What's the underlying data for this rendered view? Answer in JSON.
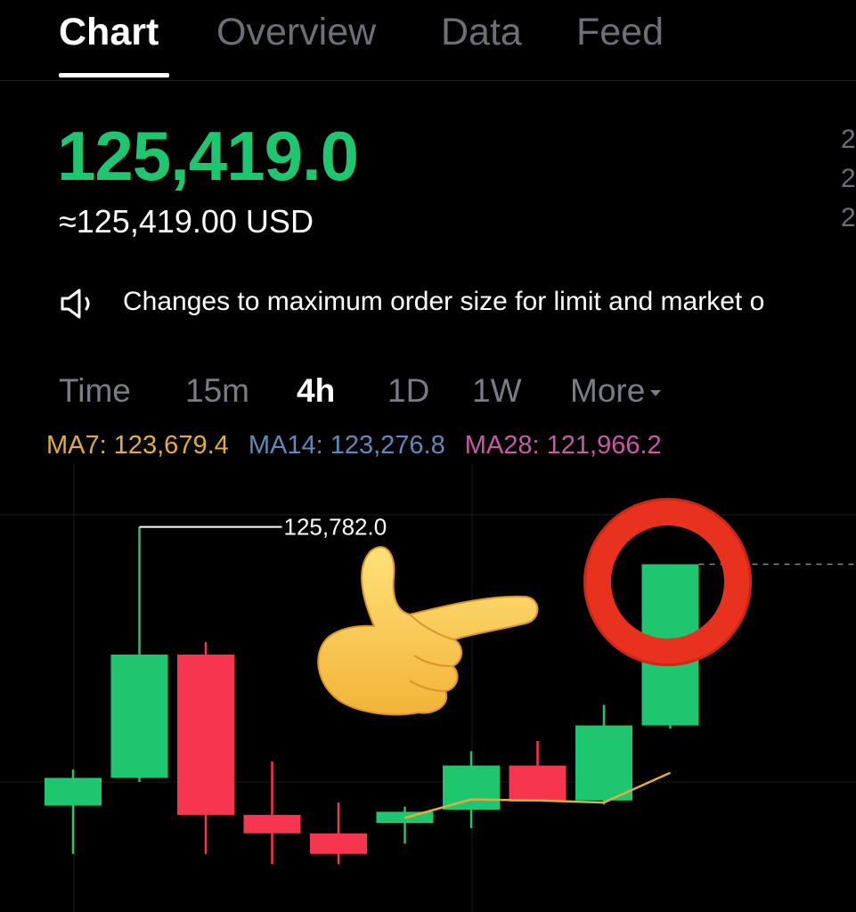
{
  "tabs": [
    {
      "label": "Chart",
      "active": true
    },
    {
      "label": "Overview",
      "active": false
    },
    {
      "label": "Data",
      "active": false
    },
    {
      "label": "Feed",
      "active": false
    }
  ],
  "price": {
    "value": "125,419.0",
    "converted": "≈125,419.00 USD",
    "color": "#1ec66f"
  },
  "side_values": [
    "2",
    "2",
    "2"
  ],
  "announcement": {
    "icon": "speaker-icon",
    "text": "Changes to maximum order size for limit and market o"
  },
  "intervals": [
    {
      "label": "Time",
      "active": false
    },
    {
      "label": "15m",
      "active": false
    },
    {
      "label": "4h",
      "active": true
    },
    {
      "label": "1D",
      "active": false
    },
    {
      "label": "1W",
      "active": false
    },
    {
      "label": "More",
      "active": false
    }
  ],
  "ma": [
    {
      "label": "MA7: 123,679.4",
      "color": "#e2ad3f"
    },
    {
      "label": "MA14: 123,276.8",
      "color": "#5e8bb7"
    },
    {
      "label": "MA28: 121,966.2",
      "color": "#c85aa6"
    }
  ],
  "overlays": {
    "hand": "pointing-hand-emoji",
    "ring": "red-circle-ring"
  },
  "chart_data": {
    "type": "candlestick",
    "colors": {
      "up": "#1ec66f",
      "down": "#f6364f"
    },
    "high_label": "125,782.0",
    "ylim": [
      122800,
      125900
    ],
    "candles": [
      {
        "o": 123070,
        "h": 123420,
        "l": 122600,
        "c": 123340
      },
      {
        "o": 123340,
        "h": 125782,
        "l": 123300,
        "c": 124540
      },
      {
        "o": 124540,
        "h": 124660,
        "l": 122600,
        "c": 122980
      },
      {
        "o": 122980,
        "h": 123500,
        "l": 122500,
        "c": 122800
      },
      {
        "o": 122800,
        "h": 123100,
        "l": 122500,
        "c": 122600
      },
      {
        "o": 122900,
        "h": 123060,
        "l": 122700,
        "c": 123010
      },
      {
        "o": 123030,
        "h": 123600,
        "l": 122850,
        "c": 123460
      },
      {
        "o": 123460,
        "h": 123700,
        "l": 123120,
        "c": 123110
      },
      {
        "o": 123120,
        "h": 124050,
        "l": 123080,
        "c": 123850
      },
      {
        "o": 123850,
        "h": 125419,
        "l": 123820,
        "c": 125419
      }
    ],
    "ma7": [
      null,
      null,
      null,
      null,
      null,
      122950,
      123130,
      123120,
      123100,
      123390
    ],
    "current_price": 125419,
    "grid": true
  }
}
